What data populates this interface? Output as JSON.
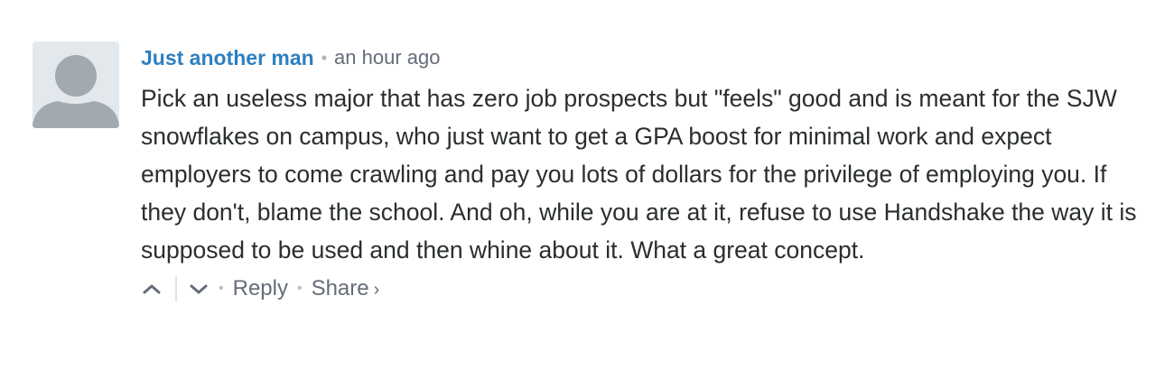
{
  "comment": {
    "author": "Just another man",
    "meta_separator": "•",
    "timestamp": "an hour ago",
    "text": "Pick an useless major that has zero job prospects but \"feels\" good and is meant for the SJW snowflakes on campus, who just want to get a GPA boost for minimal work and expect employers to come crawling and pay you lots of dollars for the privilege of employing you. If they don't, blame the school. And oh, while you are at it, refuse to use Handshake the way it is supposed to be used and then whine about it. What a great concept.",
    "avatar_icon": "default-user-avatar-icon"
  },
  "footer": {
    "upvote_icon": "chevron-up-icon",
    "downvote_icon": "chevron-down-icon",
    "separator": "•",
    "reply_label": "Reply",
    "share_label": "Share",
    "share_chevron": "›"
  },
  "colors": {
    "author": "#2e7fbf",
    "meta": "#656c7a",
    "text": "#2a2e2e",
    "avatar_bg": "#e3e8ec",
    "avatar_fg": "#a1a9b1"
  }
}
